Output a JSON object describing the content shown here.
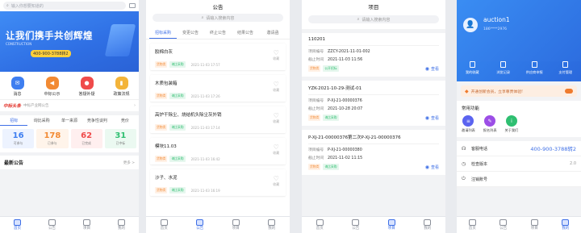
{
  "screen1": {
    "search_placeholder": "输入你想要知道的",
    "banner": {
      "title": "让我们携手共创辉煌",
      "subtitle": "CONSTRUCTION",
      "phone": "400-900-3788转2"
    },
    "quick": [
      {
        "label": "消息",
        "icon": "message-icon",
        "color": "#3e7ef0"
      },
      {
        "label": "中标公示",
        "icon": "megaphone-icon",
        "color": "#f28a33"
      },
      {
        "label": "答疑补疑",
        "icon": "bulb-icon",
        "color": "#ef4b4b"
      },
      {
        "label": "政策法规",
        "icon": "bookmark-icon",
        "color": "#f3b43a"
      }
    ],
    "news": {
      "brand": "中标头条",
      "text": "中标产业网公告"
    },
    "tabs": [
      "招标",
      "询比采购",
      "单一来源",
      "竞争性谈判",
      "竞价"
    ],
    "stats": [
      {
        "num": "16",
        "label": "可参与",
        "color": "#3e7ef0",
        "bg": "#edf3ff"
      },
      {
        "num": "178",
        "label": "已参与",
        "color": "#f28a33",
        "bg": "#fff4ea"
      },
      {
        "num": "62",
        "label": "已完成",
        "color": "#ef4b4b",
        "bg": "#ffefef"
      },
      {
        "num": "31",
        "label": "已中标",
        "color": "#2fbf71",
        "bg": "#ebf9f1"
      }
    ],
    "section": {
      "title": "最新公告",
      "more": "更多 >"
    }
  },
  "screen2": {
    "title": "公告",
    "search_placeholder": "请输入搜索内容",
    "tabs": [
      "招标采购",
      "变更公告",
      "终止公告",
      "结果公告",
      "邀请函"
    ],
    "items": [
      {
        "title": "胶棉白灰",
        "tag1": "货物类",
        "tag2": "询比采购",
        "date": "2021-11-03 17:57",
        "fav": "收藏"
      },
      {
        "title": "木质包装箱",
        "tag1": "货物类",
        "tag2": "询比采购",
        "date": "2021-11-03 17:26",
        "fav": "收藏"
      },
      {
        "title": "高炉干除尘、烧结机头除尘灰外销",
        "tag1": "货物类",
        "tag2": "询比采购",
        "date": "2021-11-03 17:14",
        "fav": "收藏"
      },
      {
        "title": "模块11.03",
        "tag1": "货物类",
        "tag2": "询比采购",
        "date": "2021-11-03 16:42",
        "fav": "收藏"
      },
      {
        "title": "沙子、水泥",
        "tag1": "货物类",
        "tag2": "询比采购",
        "date": "2021-11-03 16:19",
        "fav": "收藏"
      }
    ]
  },
  "screen3": {
    "title": "项目",
    "search_placeholder": "请输入搜索内容",
    "key_no": "项目编号",
    "key_deadline": "截止时间",
    "view": "查看",
    "cards": [
      {
        "title": "110201",
        "no": "ZZCY-2021-11-01-002",
        "deadline": "2021-11-03 11:56",
        "tag1": "货物类",
        "tag2": "公开招标"
      },
      {
        "title": "YZK-2021-10-29-测试-01",
        "no": "P-XJ-21-00000376",
        "deadline": "2021-10-28 20:07",
        "tag1": "货物类",
        "tag2": "询比采购"
      },
      {
        "title": "P-XJ-21-00000376第二次P-XJ-21-00000376",
        "no": "P-XJ-21-00000380",
        "deadline": "2021-11-02 11:15",
        "tag1": "货物类",
        "tag2": "询比采购"
      }
    ]
  },
  "screen4": {
    "username": "auction1",
    "phone": "186****2976",
    "menu": [
      "我的收藏",
      "浏览记录",
      "供应商申报",
      "支付管理"
    ],
    "vip_text": "开通创新会员，立享尊贵体验!",
    "func_title": "常用功能",
    "funcs": [
      {
        "label": "邀请列表",
        "color": "#5b64f0"
      },
      {
        "label": "报名列表",
        "color": "#9c4ee6"
      },
      {
        "label": "关于我们",
        "color": "#2fbf71"
      }
    ],
    "list": [
      {
        "label": "客服电话",
        "value": "400-900-3788转2"
      },
      {
        "label": "检查版本",
        "value": "2.0"
      },
      {
        "label": "注销账号",
        "value": ""
      }
    ]
  },
  "nav": [
    "首页",
    "公告",
    "项目",
    "我的"
  ]
}
